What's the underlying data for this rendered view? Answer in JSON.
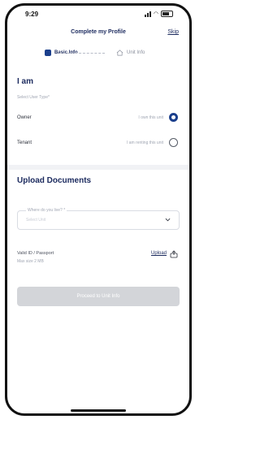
{
  "status_bar": {
    "time": "9:29"
  },
  "header": {
    "title": "Complete my Profile",
    "skip": "Skip"
  },
  "tabs": [
    {
      "label": "Basic Info",
      "active": true
    },
    {
      "label": "Unit Info",
      "active": false
    }
  ],
  "iam": {
    "title": "I am",
    "hint": "Select User Type*",
    "options": [
      {
        "label": "Owner",
        "desc": "I own this unit",
        "selected": true
      },
      {
        "label": "Tenant",
        "desc": "I am renting this unit",
        "selected": false
      }
    ]
  },
  "upload": {
    "title": "Upload Documents",
    "select_legend": "Where do you live? *",
    "select_value": "Select Unit",
    "doc_name": "Valid ID / Passport",
    "doc_size": "Max size 2 MB",
    "upload_label": "Upload"
  },
  "proceed_label": "Proceed to Unit Info",
  "colors": {
    "primary": "#1b3f8c",
    "title": "#1b2a5e",
    "disabled": "#d3d5d9"
  }
}
